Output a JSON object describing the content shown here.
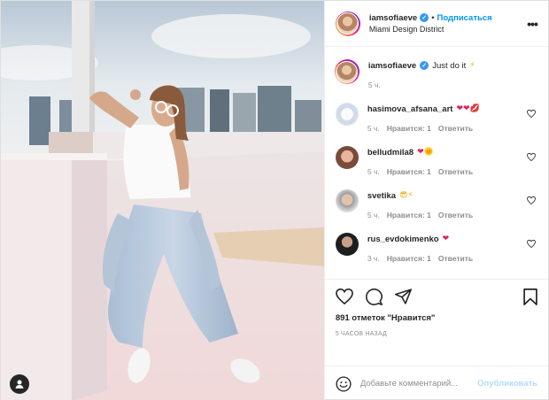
{
  "post": {
    "author": "iamsofiaeve",
    "follow_label": "Подписаться",
    "location": "Miami Design District",
    "caption_text": "Just do it",
    "caption_emoji": "⚡",
    "caption_time": "5 ч."
  },
  "comments": [
    {
      "user": "hasimova_afsana_art",
      "emoji": "❤❤💋",
      "time": "5 ч.",
      "likes": "Нравится: 1",
      "reply": "Ответить",
      "avatar_color": "#d9e4f2"
    },
    {
      "user": "belludmila8",
      "emoji": "❤🌞",
      "time": "5 ч.",
      "likes": "Нравится: 1",
      "reply": "Ответить",
      "avatar_color": "#9a6a55"
    },
    {
      "user": "svetika",
      "emoji": "😎⚡",
      "time": "5 ч.",
      "likes": "Нравится: 1",
      "reply": "Ответить",
      "avatar_color": "#c8c8c8"
    },
    {
      "user": "rus_evdokimenko",
      "emoji": "❤",
      "time": "3 ч.",
      "likes": "Нравится: 1",
      "reply": "Ответить",
      "avatar_color": "#2a2a2a"
    }
  ],
  "footer": {
    "likes_count": "891 отметок \"Нравится\"",
    "timestamp": "5 ЧАСОВ НАЗАД",
    "comment_placeholder": "Добавьте комментарий...",
    "publish_label": "Опубликовать"
  },
  "icons": [
    "user-tag-icon",
    "verified-icon",
    "more-options-icon",
    "like-icon",
    "comment-icon",
    "share-icon",
    "save-icon",
    "emoji-icon"
  ],
  "colors": {
    "accent": "#0095f6",
    "verified": "#3897f0",
    "heart": "#e0245e",
    "publish_disabled": "#b3dbff"
  }
}
